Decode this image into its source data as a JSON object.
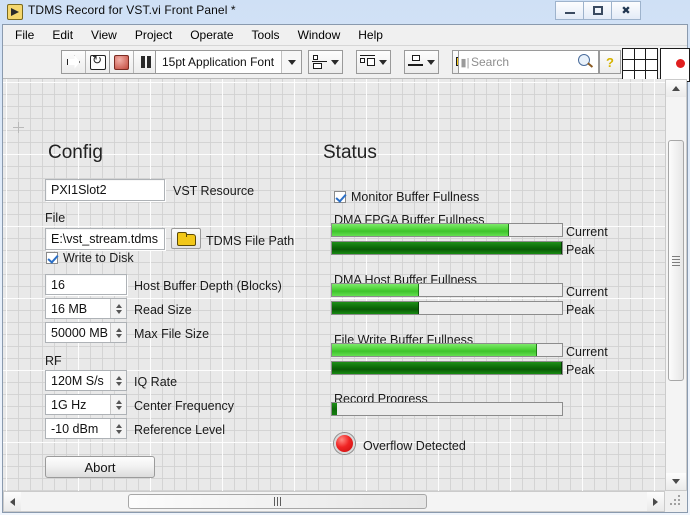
{
  "window": {
    "title": "TDMS Record for VST.vi Front Panel *",
    "minimize_label": "Minimize",
    "maximize_label": "Restore",
    "close_label": "Close"
  },
  "menu": {
    "items": [
      "File",
      "Edit",
      "View",
      "Project",
      "Operate",
      "Tools",
      "Window",
      "Help"
    ]
  },
  "toolbar": {
    "run_label": "Run",
    "run_continuously_label": "Run Continuously",
    "abort_label": "Abort Execution",
    "pause_label": "Pause",
    "font_selector": "15pt Application Font",
    "align_label": "Align Objects",
    "distribute_label": "Distribute Objects",
    "resize_label": "Resize Objects",
    "reorder_label": "Reorder",
    "search_placeholder": "Search",
    "search_value": "Search",
    "help_label": "Show Context Help"
  },
  "panel": {
    "config": {
      "title": "Config",
      "vst_resource": {
        "value": "PXI1Slot2",
        "label": "VST Resource"
      },
      "file_group_label": "File",
      "tdms_path": {
        "value": "E:\\vst_stream.tdms",
        "label": "TDMS File Path"
      },
      "write_to_disk": {
        "label": "Write to Disk",
        "checked": true
      },
      "host_buffer_depth": {
        "value": "16",
        "label": "Host Buffer Depth (Blocks)"
      },
      "read_size": {
        "value": "16 MB",
        "label": "Read Size"
      },
      "max_file_size": {
        "value": "50000 MB",
        "label": "Max File Size"
      },
      "rf_group_label": "RF",
      "iq_rate": {
        "value": "120M S/s",
        "label": "IQ Rate"
      },
      "center_frequency": {
        "value": "1G Hz",
        "label": "Center Frequency"
      },
      "reference_level": {
        "value": "-10 dBm",
        "label": "Reference Level"
      },
      "abort_button": "Abort"
    },
    "status": {
      "title": "Status",
      "monitor_buffer_fullness": {
        "label": "Monitor Buffer Fullness",
        "checked": true
      },
      "dma_fpga": {
        "label": "DMA FPGA Buffer Fullness",
        "current_label": "Current",
        "peak_label": "Peak",
        "current_percent": 77,
        "peak_percent": 100
      },
      "dma_host": {
        "label": "DMA Host Buffer Fullness",
        "current_label": "Current",
        "peak_label": "Peak",
        "current_percent": 38,
        "peak_percent": 38
      },
      "file_write": {
        "label": "File Write Buffer Fullness",
        "current_label": "Current",
        "peak_label": "Peak",
        "current_percent": 89,
        "peak_percent": 100
      },
      "record_progress": {
        "label": "Record Progress",
        "percent": 2
      },
      "overflow_detected": {
        "label": "Overflow Detected",
        "on": true
      }
    }
  },
  "colors": {
    "bar_current": "#4fd43a",
    "bar_peak": "#0c6a08",
    "led_on": "#f02424",
    "panel_grid": "#d0d0d0",
    "panel_bg": "#e9e9e9"
  }
}
